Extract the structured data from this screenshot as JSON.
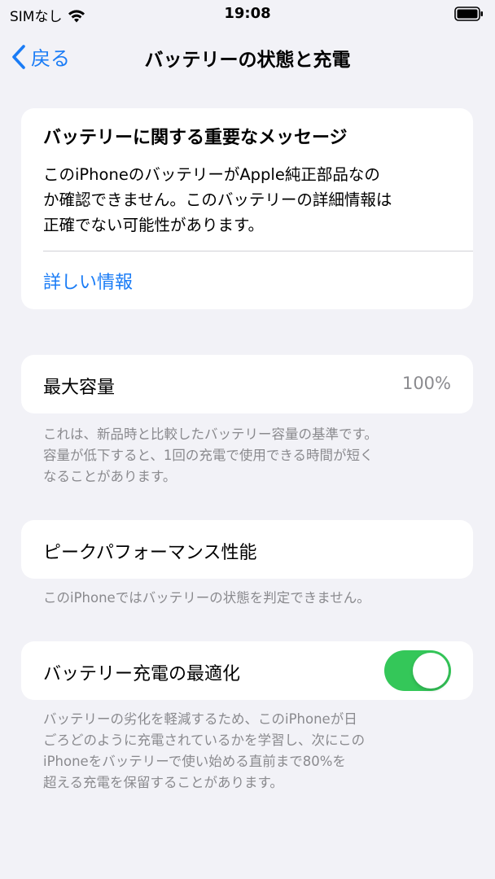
{
  "status": {
    "carrier": "SIMなし",
    "time": "19:08"
  },
  "nav": {
    "back_label": "戻る",
    "title": "バッテリーの状態と充電"
  },
  "message_card": {
    "title": "バッテリーに関する重要なメッセージ",
    "body_lines": [
      "このiPhoneのバッテリーがApple純正部品なの",
      "か確認できません。このバッテリーの詳細情報は",
      "正確でない可能性があります。"
    ],
    "link": "詳しい情報"
  },
  "capacity": {
    "label": "最大容量",
    "value": "100%",
    "footnote_lines": [
      "これは、新品時と比較したバッテリー容量の基準です。",
      "容量が低下すると、1回の充電で使用できる時間が短く",
      "なることがあります。"
    ]
  },
  "peak": {
    "label": "ピークパフォーマンス性能",
    "footnote": "このiPhoneではバッテリーの状態を判定できません。"
  },
  "optimized": {
    "label": "バッテリー充電の最適化",
    "enabled": "on",
    "footnote_lines": [
      "バッテリーの劣化を軽減するため、このiPhoneが日",
      "ごろどのように充電されているかを学習し、次にこの",
      "iPhoneをバッテリーで使い始める直前まで80%を",
      "超える充電を保留することがあります。"
    ]
  },
  "colors": {
    "accent": "#1a7cf6",
    "toggle_on": "#34c759",
    "background": "#f2f2f7",
    "secondary_text": "#8a8a8e"
  },
  "icons": [
    "wifi-icon",
    "battery-icon",
    "chevron-left-icon"
  ]
}
